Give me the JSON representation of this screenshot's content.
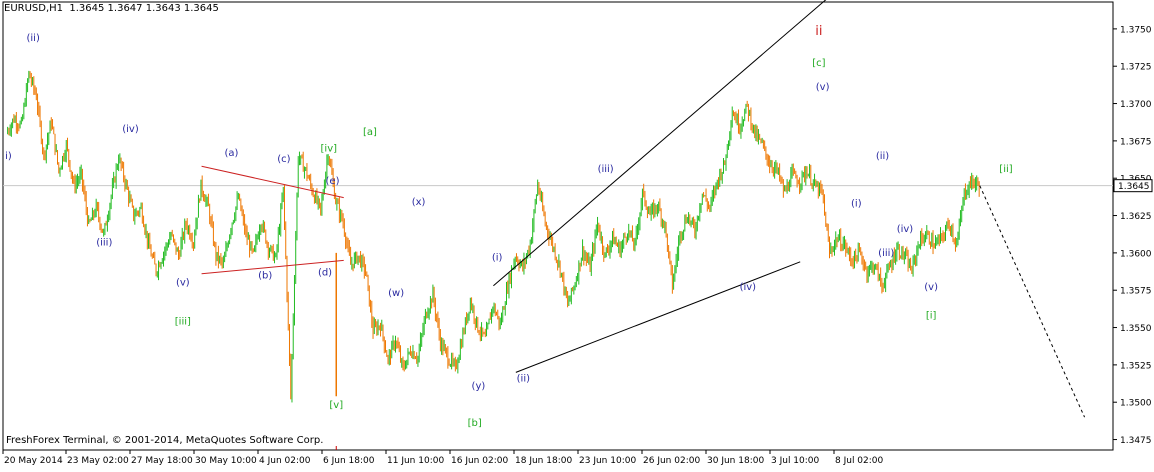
{
  "header": {
    "symbol": "EURUSD,H1",
    "ohlc": "1.3645 1.3647 1.3643 1.3645"
  },
  "copyright": "FreshForex Terminal, © 2001-2014, MetaQuotes Software Corp.",
  "colors": {
    "candle_up": "#22bb22",
    "candle_down": "#ee7700",
    "wave_blue": "#2a2aa0",
    "wave_green": "#22aa22",
    "wave_red": "#cc2222",
    "triangle": "#cc2222",
    "channel": "#000000",
    "grid": "#c8c8c8",
    "price_tag_bg": "#ffffff"
  },
  "chart_data": {
    "type": "candlestick",
    "symbol": "EURUSD",
    "timeframe": "H1",
    "x_tick_labels": [
      "20 May 2014",
      "23 May 02:00",
      "27 May 18:00",
      "30 May 10:00",
      "4 Jun 02:00",
      "6 Jun 18:00",
      "11 Jun 10:00",
      "16 Jun 02:00",
      "18 Jun 18:00",
      "23 Jun 10:00",
      "26 Jun 02:00",
      "30 Jun 18:00",
      "3 Jul 10:00",
      "8 Jul 02:00"
    ],
    "y_tick_labels": [
      "1.3750",
      "1.3725",
      "1.3700",
      "1.3675",
      "1.3650",
      "1.3625",
      "1.3600",
      "1.3575",
      "1.3550",
      "1.3525",
      "1.3500",
      "1.3475"
    ],
    "ylim": [
      1.3468,
      1.3768
    ],
    "current_price": "1.3645",
    "price_path": [
      [
        0,
        1.368
      ],
      [
        1,
        1.369
      ],
      [
        2,
        1.3685
      ],
      [
        3,
        1.372
      ],
      [
        4,
        1.3705
      ],
      [
        5,
        1.3665
      ],
      [
        6,
        1.3688
      ],
      [
        7,
        1.3655
      ],
      [
        8,
        1.3672
      ],
      [
        9,
        1.3645
      ],
      [
        10,
        1.3652
      ],
      [
        11,
        1.3618
      ],
      [
        12,
        1.363
      ],
      [
        13,
        1.3612
      ],
      [
        14,
        1.3638
      ],
      [
        15,
        1.3664
      ],
      [
        16,
        1.3645
      ],
      [
        17,
        1.3625
      ],
      [
        18,
        1.363
      ],
      [
        19,
        1.3605
      ],
      [
        20,
        1.3588
      ],
      [
        21,
        1.36
      ],
      [
        22,
        1.3612
      ],
      [
        23,
        1.3598
      ],
      [
        24,
        1.362
      ],
      [
        25,
        1.3608
      ],
      [
        26,
        1.3645
      ],
      [
        27,
        1.363
      ],
      [
        28,
        1.3598
      ],
      [
        29,
        1.3592
      ],
      [
        30,
        1.3618
      ],
      [
        31,
        1.3637
      ],
      [
        32,
        1.3612
      ],
      [
        33,
        1.3598
      ],
      [
        34,
        1.3622
      ],
      [
        35,
        1.3604
      ],
      [
        36,
        1.3596
      ],
      [
        37,
        1.3642
      ],
      [
        38,
        1.3504
      ],
      [
        39,
        1.3665
      ],
      [
        40,
        1.3655
      ],
      [
        41,
        1.364
      ],
      [
        42,
        1.3628
      ],
      [
        43,
        1.3668
      ],
      [
        44,
        1.3635
      ],
      [
        45,
        1.362
      ],
      [
        46,
        1.3592
      ],
      [
        47,
        1.3598
      ],
      [
        48,
        1.3588
      ],
      [
        49,
        1.3548
      ],
      [
        50,
        1.3552
      ],
      [
        51,
        1.3528
      ],
      [
        52,
        1.3542
      ],
      [
        53,
        1.3522
      ],
      [
        54,
        1.3535
      ],
      [
        55,
        1.353
      ],
      [
        56,
        1.3558
      ],
      [
        57,
        1.3572
      ],
      [
        58,
        1.354
      ],
      [
        59,
        1.353
      ],
      [
        60,
        1.3522
      ],
      [
        61,
        1.3545
      ],
      [
        62,
        1.3568
      ],
      [
        63,
        1.355
      ],
      [
        64,
        1.3542
      ],
      [
        65,
        1.3565
      ],
      [
        66,
        1.3552
      ],
      [
        67,
        1.3578
      ],
      [
        68,
        1.3598
      ],
      [
        69,
        1.359
      ],
      [
        70,
        1.3606
      ],
      [
        71,
        1.3646
      ],
      [
        72,
        1.362
      ],
      [
        73,
        1.3605
      ],
      [
        74,
        1.359
      ],
      [
        75,
        1.3565
      ],
      [
        76,
        1.358
      ],
      [
        77,
        1.3602
      ],
      [
        78,
        1.359
      ],
      [
        79,
        1.362
      ],
      [
        80,
        1.3598
      ],
      [
        81,
        1.361
      ],
      [
        82,
        1.3602
      ],
      [
        83,
        1.3615
      ],
      [
        84,
        1.3605
      ],
      [
        85,
        1.364
      ],
      [
        86,
        1.3625
      ],
      [
        87,
        1.3632
      ],
      [
        88,
        1.3618
      ],
      [
        89,
        1.3578
      ],
      [
        90,
        1.3612
      ],
      [
        91,
        1.3625
      ],
      [
        92,
        1.3615
      ],
      [
        93,
        1.364
      ],
      [
        94,
        1.363
      ],
      [
        95,
        1.3648
      ],
      [
        96,
        1.366
      ],
      [
        97,
        1.3695
      ],
      [
        98,
        1.3685
      ],
      [
        99,
        1.3698
      ],
      [
        100,
        1.368
      ],
      [
        101,
        1.3672
      ],
      [
        102,
        1.366
      ],
      [
        103,
        1.3655
      ],
      [
        104,
        1.364
      ],
      [
        105,
        1.3652
      ],
      [
        106,
        1.3648
      ],
      [
        107,
        1.3655
      ],
      [
        108,
        1.3645
      ],
      [
        109,
        1.364
      ],
      [
        110,
        1.36
      ],
      [
        111,
        1.361
      ],
      [
        112,
        1.3605
      ],
      [
        113,
        1.3595
      ],
      [
        114,
        1.36
      ],
      [
        115,
        1.3588
      ],
      [
        116,
        1.3592
      ],
      [
        117,
        1.3578
      ],
      [
        118,
        1.359
      ],
      [
        119,
        1.3603
      ],
      [
        120,
        1.3598
      ],
      [
        121,
        1.3588
      ],
      [
        122,
        1.3608
      ],
      [
        123,
        1.3612
      ],
      [
        124,
        1.3605
      ],
      [
        125,
        1.361
      ],
      [
        126,
        1.362
      ],
      [
        127,
        1.3605
      ],
      [
        128,
        1.364
      ],
      [
        129,
        1.3648
      ],
      [
        130,
        1.3645
      ]
    ],
    "x_index_range": [
      0,
      130
    ],
    "forecast": {
      "from": [
        130,
        1.3645
      ],
      "to": [
        144,
        1.349
      ]
    },
    "triangle_lines": [
      {
        "from": [
          26,
          1.3658
        ],
        "to": [
          45,
          1.3637
        ]
      },
      {
        "from": [
          26,
          1.3586
        ],
        "to": [
          45,
          1.3595
        ]
      }
    ],
    "channel_lines": [
      {
        "from": [
          65,
          1.3578
        ],
        "to": [
          110,
          1.3772
        ]
      },
      {
        "from": [
          68,
          1.352
        ],
        "to": [
          106,
          1.3594
        ]
      }
    ],
    "wave_labels": [
      {
        "text": "(ii)",
        "x": 3.5,
        "y": 1.3742,
        "color": "blue"
      },
      {
        "text": "i)",
        "x": 0.2,
        "y": 1.3663,
        "color": "blue"
      },
      {
        "text": "(iv)",
        "x": 16.5,
        "y": 1.3681,
        "color": "blue"
      },
      {
        "text": "(iii)",
        "x": 13,
        "y": 1.3605,
        "color": "blue"
      },
      {
        "text": "(v)",
        "x": 23.5,
        "y": 1.3578,
        "color": "blue"
      },
      {
        "text": "[iii]",
        "x": 23.5,
        "y": 1.3552,
        "color": "green"
      },
      {
        "text": "(a)",
        "x": 30,
        "y": 1.3665,
        "color": "blue"
      },
      {
        "text": "(b)",
        "x": 34.5,
        "y": 1.3583,
        "color": "blue"
      },
      {
        "text": "(c)",
        "x": 37,
        "y": 1.3661,
        "color": "blue"
      },
      {
        "text": "(d)",
        "x": 42.5,
        "y": 1.3585,
        "color": "blue"
      },
      {
        "text": "(e)",
        "x": 43.5,
        "y": 1.3646,
        "color": "blue"
      },
      {
        "text": "[iv]",
        "x": 43,
        "y": 1.3668,
        "color": "green"
      },
      {
        "text": "[a]",
        "x": 48.5,
        "y": 1.3679,
        "color": "green"
      },
      {
        "text": "[v]",
        "x": 44,
        "y": 1.3496,
        "color": "green"
      },
      {
        "text": "(x)",
        "x": 55,
        "y": 1.3632,
        "color": "blue"
      },
      {
        "text": "(w)",
        "x": 52,
        "y": 1.3571,
        "color": "blue"
      },
      {
        "text": "(i)",
        "x": 65.5,
        "y": 1.3595,
        "color": "blue"
      },
      {
        "text": "(y)",
        "x": 63,
        "y": 1.3509,
        "color": "blue"
      },
      {
        "text": "[b]",
        "x": 62.5,
        "y": 1.3484,
        "color": "green"
      },
      {
        "text": "(ii)",
        "x": 69,
        "y": 1.3514,
        "color": "blue"
      },
      {
        "text": "(iii)",
        "x": 80,
        "y": 1.3654,
        "color": "blue"
      },
      {
        "text": "(iv)",
        "x": 99,
        "y": 1.3575,
        "color": "blue"
      },
      {
        "text": "ii",
        "x": 108.5,
        "y": 1.3746,
        "color": "red"
      },
      {
        "text": "[c]",
        "x": 108.5,
        "y": 1.3725,
        "color": "green"
      },
      {
        "text": "(v)",
        "x": 109,
        "y": 1.3709,
        "color": "blue"
      },
      {
        "text": "(ii)",
        "x": 117,
        "y": 1.3663,
        "color": "blue"
      },
      {
        "text": "(i)",
        "x": 113.5,
        "y": 1.3631,
        "color": "blue"
      },
      {
        "text": "(iv)",
        "x": 120,
        "y": 1.3614,
        "color": "blue"
      },
      {
        "text": "(iii)",
        "x": 117.5,
        "y": 1.3598,
        "color": "blue"
      },
      {
        "text": "(v)",
        "x": 123.5,
        "y": 1.3575,
        "color": "blue"
      },
      {
        "text": "[i]",
        "x": 123.5,
        "y": 1.3556,
        "color": "green"
      },
      {
        "text": "[ii]",
        "x": 133.5,
        "y": 1.3654,
        "color": "green"
      }
    ]
  }
}
